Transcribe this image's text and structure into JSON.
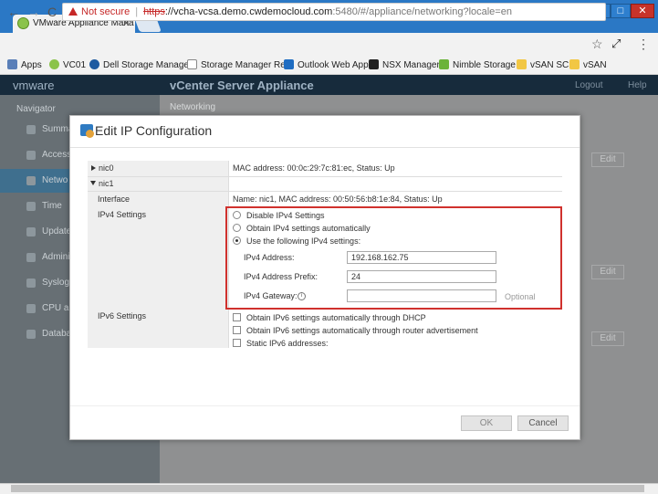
{
  "browser": {
    "tab_title": "VMware Appliance Mana",
    "address": {
      "warning": "Not secure",
      "scheme": "https",
      "host": "://vcha-vcsa.demo.cwdemocloud.com",
      "path": ":5480/#/appliance/networking?locale=en"
    },
    "bookmarks": [
      {
        "label": "Apps"
      },
      {
        "label": "VC01"
      },
      {
        "label": "Dell Storage Manage"
      },
      {
        "label": "Storage Manager Re"
      },
      {
        "label": "Outlook Web App"
      },
      {
        "label": "NSX Manager"
      },
      {
        "label": "Nimble Storage"
      },
      {
        "label": "vSAN SC"
      },
      {
        "label": "vSAN"
      }
    ]
  },
  "app": {
    "logo": "vmware",
    "title": "vCenter Server Appliance",
    "logout": "Logout",
    "help": "Help",
    "navigator": "Navigator",
    "nav_items": [
      {
        "label": "Summa"
      },
      {
        "label": "Access"
      },
      {
        "label": "Netwo"
      },
      {
        "label": "Time"
      },
      {
        "label": "Update"
      },
      {
        "label": "Admini"
      },
      {
        "label": "Syslog"
      },
      {
        "label": "CPU an"
      },
      {
        "label": "Databa"
      }
    ],
    "main_heading": "Networking",
    "edit_label": "Edit"
  },
  "dialog": {
    "title": "Edit IP Configuration",
    "nic0": {
      "label": "nic0",
      "info": "MAC address: 00:0c:29:7c:81:ec, Status: Up"
    },
    "nic1": {
      "label": "nic1"
    },
    "interface": {
      "label": "Interface",
      "value": "Name: nic1, MAC address: 00:50:56:b8:1e:84, Status: Up"
    },
    "ipv4": {
      "label": "IPv4 Settings",
      "options": [
        {
          "label": "Disable IPv4 Settings",
          "selected": false
        },
        {
          "label": "Obtain IPv4 settings automatically",
          "selected": false
        },
        {
          "label": "Use the following IPv4 settings:",
          "selected": true
        }
      ],
      "address_label": "IPv4 Address:",
      "address_value": "192.168.162.75",
      "prefix_label": "IPv4 Address Prefix:",
      "prefix_value": "24",
      "gateway_label": "IPv4 Gateway:",
      "gateway_value": "",
      "gateway_optional": "Optional"
    },
    "ipv6": {
      "label": "IPv6 Settings",
      "options": [
        {
          "label": "Obtain IPv6 settings automatically through DHCP",
          "checked": false
        },
        {
          "label": "Obtain IPv6 settings automatically through router advertisement",
          "checked": false
        },
        {
          "label": "Static IPv6 addresses:",
          "checked": false
        }
      ]
    },
    "ok": "OK",
    "cancel": "Cancel"
  }
}
